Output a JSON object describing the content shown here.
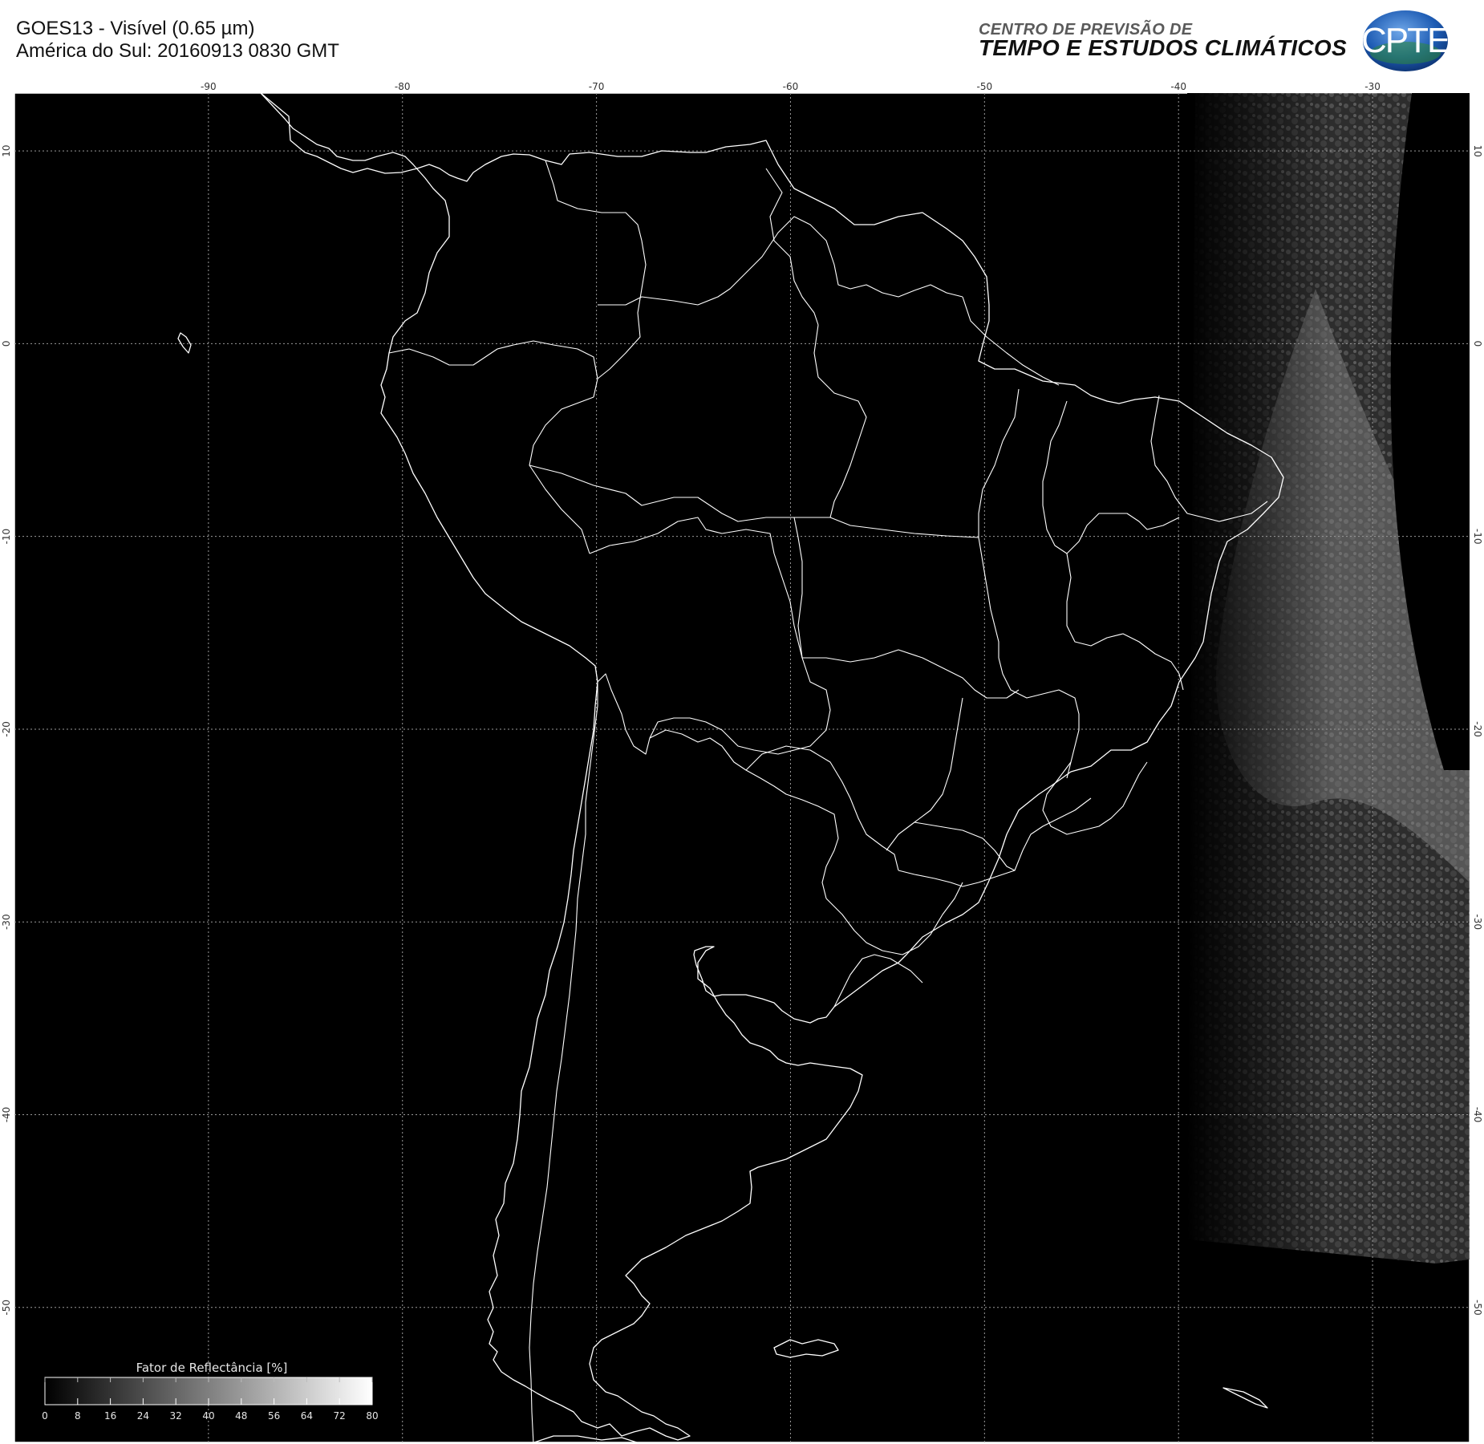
{
  "header": {
    "title_line1": "GOES13 - Visível (0.65 µm)",
    "title_line2": "América do Sul: 20160913 0830 GMT",
    "org_line1": "CENTRO DE PREVISÃO DE",
    "org_line2": "TEMPO E ESTUDOS CLIMÁTICOS",
    "logo_text": "CPTEC"
  },
  "map": {
    "lon_range": [
      -100,
      -25
    ],
    "lat_range": [
      -57,
      13
    ],
    "grid": true,
    "lon_ticks": [
      {
        "value": -90,
        "label": "-90"
      },
      {
        "value": -80,
        "label": "-80"
      },
      {
        "value": -70,
        "label": "-70"
      },
      {
        "value": -60,
        "label": "-60"
      },
      {
        "value": -50,
        "label": "-50"
      },
      {
        "value": -40,
        "label": "-40"
      },
      {
        "value": -30,
        "label": "-30"
      }
    ],
    "lat_ticks": [
      {
        "value": 10,
        "label": "10"
      },
      {
        "value": 0,
        "label": "0"
      },
      {
        "value": -10,
        "label": "-10"
      },
      {
        "value": -20,
        "label": "-20"
      },
      {
        "value": -30,
        "label": "-30"
      },
      {
        "value": -40,
        "label": "-40"
      },
      {
        "value": -50,
        "label": "-50"
      }
    ]
  },
  "colorbar": {
    "label": "Fator de Reflectância [%]",
    "ticks": [
      "0",
      "8",
      "16",
      "24",
      "32",
      "40",
      "48",
      "56",
      "64",
      "72",
      "80"
    ]
  },
  "colors": {
    "background": "#000000",
    "coastline": "#ffffff",
    "grid": "#9a9a9a"
  }
}
